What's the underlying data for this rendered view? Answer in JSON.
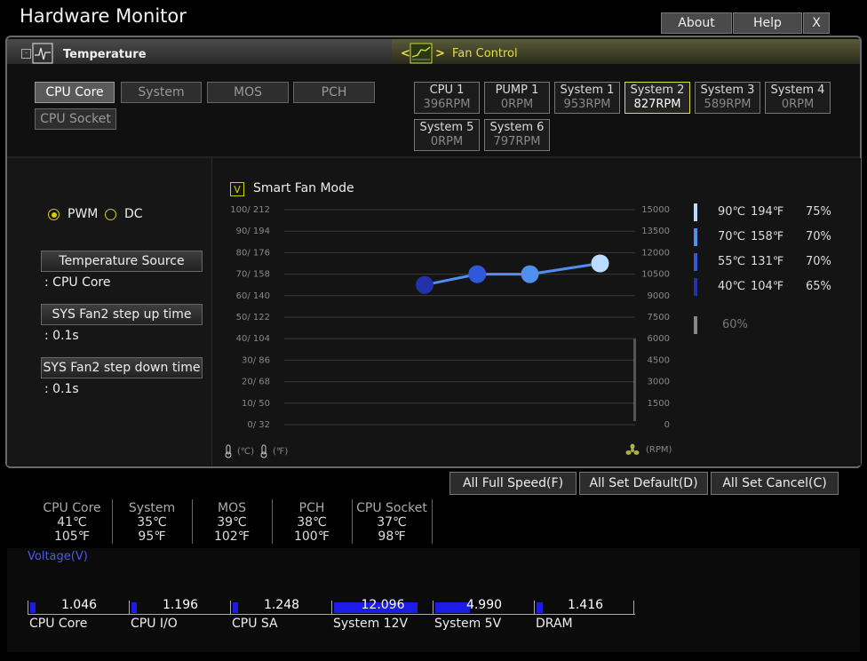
{
  "app_title": "Hardware Monitor",
  "top_buttons": {
    "about": "About",
    "help": "Help",
    "close": "X"
  },
  "temperature_tab": {
    "label": "Temperature"
  },
  "fan_control_tab": {
    "label": "Fan Control",
    "prev": "<",
    "next": ">"
  },
  "sensor_buttons": [
    {
      "label": "CPU Core",
      "selected": true
    },
    {
      "label": "System",
      "selected": false
    },
    {
      "label": "MOS",
      "selected": false
    },
    {
      "label": "PCH",
      "selected": false
    },
    {
      "label": "CPU Socket",
      "selected": false
    }
  ],
  "fans": [
    {
      "name": "CPU 1",
      "rpm": "396RPM"
    },
    {
      "name": "PUMP 1",
      "rpm": "0RPM"
    },
    {
      "name": "System 1",
      "rpm": "953RPM"
    },
    {
      "name": "System 2",
      "rpm": "827RPM",
      "selected": true
    },
    {
      "name": "System 3",
      "rpm": "589RPM"
    },
    {
      "name": "System 4",
      "rpm": "0RPM"
    },
    {
      "name": "System 5",
      "rpm": "0RPM"
    },
    {
      "name": "System 6",
      "rpm": "797RPM"
    }
  ],
  "mode": {
    "pwm": "PWM",
    "dc": "DC",
    "selected": "PWM"
  },
  "temperature_source": {
    "label": "Temperature Source",
    "value": ": CPU Core"
  },
  "step_up": {
    "label": "SYS Fan2 step up time",
    "value": ": 0.1s"
  },
  "step_down": {
    "label": "SYS Fan2 step down time",
    "value": ": 0.1s"
  },
  "smart_fan": {
    "check": "V",
    "label": "Smart Fan Mode",
    "checked": true
  },
  "chart_data": {
    "type": "line",
    "x": [
      40,
      55,
      70,
      90
    ],
    "values": [
      65,
      70,
      70,
      75
    ],
    "xlim": [
      0,
      100
    ],
    "ylim": [
      0,
      100
    ],
    "y_ticks": [
      "100/ 212",
      "90/ 194",
      "80/ 176",
      "70/ 158",
      "60/ 140",
      "50/ 122",
      "40/ 104",
      "30/  86",
      "20/  68",
      "10/  50",
      "0/  32"
    ],
    "rpm_ticks": [
      "15000",
      "13500",
      "12000",
      "10500",
      "9000",
      "7500",
      "6000",
      "4500",
      "3000",
      "1500",
      "0"
    ],
    "point_colors": [
      "#2233aa",
      "#2f58dd",
      "#4f8ff0",
      "#b8dcff"
    ],
    "unit_c": "(℃)",
    "unit_f": "(℉)",
    "unit_rpm": "(RPM)"
  },
  "legend": [
    {
      "c": "90℃",
      "f": "194℉",
      "pct": "75%",
      "color": "#b8dcff"
    },
    {
      "c": "70℃",
      "f": "158℉",
      "pct": "70%",
      "color": "#4f8ff0"
    },
    {
      "c": "55℃",
      "f": "131℉",
      "pct": "70%",
      "color": "#2f58dd"
    },
    {
      "c": "40℃",
      "f": "104℉",
      "pct": "65%",
      "color": "#2233aa"
    }
  ],
  "legend_min": {
    "pct": "60%",
    "color": "#888888"
  },
  "actions": {
    "full_speed": "All Full Speed(F)",
    "set_default": "All Set Default(D)",
    "set_cancel": "All Set Cancel(C)"
  },
  "temps": [
    {
      "name": "CPU Core",
      "c": "41℃",
      "f": "105℉"
    },
    {
      "name": "System",
      "c": "35℃",
      "f": "95℉"
    },
    {
      "name": "MOS",
      "c": "39℃",
      "f": "102℉"
    },
    {
      "name": "PCH",
      "c": "38℃",
      "f": "100℉"
    },
    {
      "name": "CPU Socket",
      "c": "37℃",
      "f": "98℉"
    }
  ],
  "voltage": {
    "title": "Voltage(V)",
    "items": [
      {
        "name": "CPU Core",
        "value": "1.046",
        "fill": 0.05
      },
      {
        "name": "CPU I/O",
        "value": "1.196",
        "fill": 0.05
      },
      {
        "name": "CPU SA",
        "value": "1.248",
        "fill": 0.05
      },
      {
        "name": "System 12V",
        "value": "12.096",
        "fill": 0.85
      },
      {
        "name": "System 5V",
        "value": "4.990",
        "fill": 0.35
      },
      {
        "name": "DRAM",
        "value": "1.416",
        "fill": 0.06
      }
    ]
  }
}
